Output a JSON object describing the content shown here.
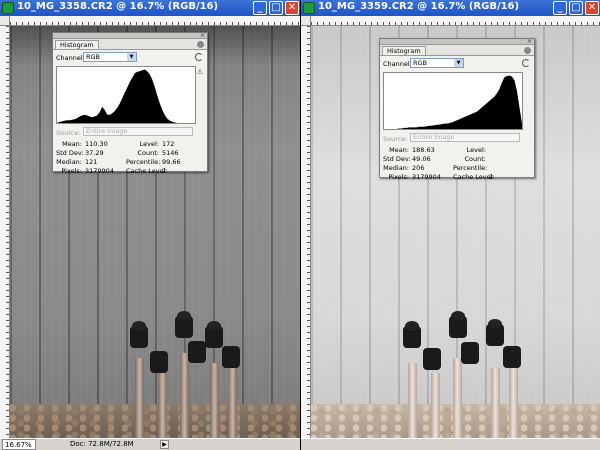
{
  "left_window": {
    "title": "10_MG_3358.CR2 @ 16.7% (RGB/16)",
    "status_zoom": "16.67%",
    "status_doc": "Doc: 72.8M/72.8M",
    "histogram": {
      "panel_tab": "Histogram",
      "channel_label": "Channel:",
      "channel_value": "RGB",
      "source_label": "Source:",
      "source_value": "Entire Image",
      "stats_left": [
        {
          "label": "Mean:",
          "value": "110.30"
        },
        {
          "label": "Std Dev:",
          "value": "37.29"
        },
        {
          "label": "Median:",
          "value": "121"
        },
        {
          "label": "Pixels:",
          "value": "3179904"
        }
      ],
      "stats_right": [
        {
          "label": "Level:",
          "value": "172"
        },
        {
          "label": "Count:",
          "value": "5146"
        },
        {
          "label": "Percentile:",
          "value": "99.66"
        },
        {
          "label": "Cache Level:",
          "value": "2"
        }
      ],
      "curve": [
        0,
        2,
        3,
        4,
        5,
        5,
        6,
        7,
        9,
        12,
        14,
        15,
        14,
        12,
        11,
        12,
        14,
        20,
        30,
        24,
        16,
        15,
        18,
        22,
        28,
        36,
        46,
        56,
        66,
        76,
        84,
        92,
        95,
        96,
        98,
        99,
        96,
        90,
        80,
        66,
        50,
        36,
        24,
        14,
        8,
        4,
        2,
        1,
        0,
        0,
        0,
        0,
        0,
        0,
        0,
        0
      ]
    }
  },
  "right_window": {
    "title": "10_MG_3359.CR2 @ 16.7% (RGB/16)",
    "histogram": {
      "panel_tab": "Histogram",
      "channel_label": "Channel:",
      "channel_value": "RGB",
      "source_label": "Source:",
      "source_value": "Entire Image",
      "stats_left": [
        {
          "label": "Mean:",
          "value": "188.63"
        },
        {
          "label": "Std Dev:",
          "value": "49.06"
        },
        {
          "label": "Median:",
          "value": "206"
        },
        {
          "label": "Pixels:",
          "value": "3179904"
        }
      ],
      "stats_right": [
        {
          "label": "Level:",
          "value": ""
        },
        {
          "label": "Count:",
          "value": ""
        },
        {
          "label": "Percentile:",
          "value": ""
        },
        {
          "label": "Cache Level:",
          "value": "2"
        }
      ],
      "curve": [
        0,
        0,
        0,
        0,
        0,
        0,
        1,
        1,
        2,
        2,
        3,
        3,
        3,
        3,
        4,
        4,
        4,
        5,
        6,
        6,
        7,
        8,
        8,
        9,
        10,
        10,
        11,
        12,
        14,
        16,
        18,
        20,
        22,
        24,
        26,
        28,
        30,
        32,
        36,
        40,
        44,
        48,
        52,
        56,
        60,
        66,
        74,
        86,
        96,
        98,
        99,
        97,
        90,
        70,
        40,
        10
      ]
    }
  },
  "window_controls": {
    "minimize": "_",
    "maximize": "□",
    "close": "✕"
  },
  "colors": {
    "titlebar": "#2a5fcf",
    "close_button": "#d8452f",
    "histogram_fill": "#000000"
  }
}
